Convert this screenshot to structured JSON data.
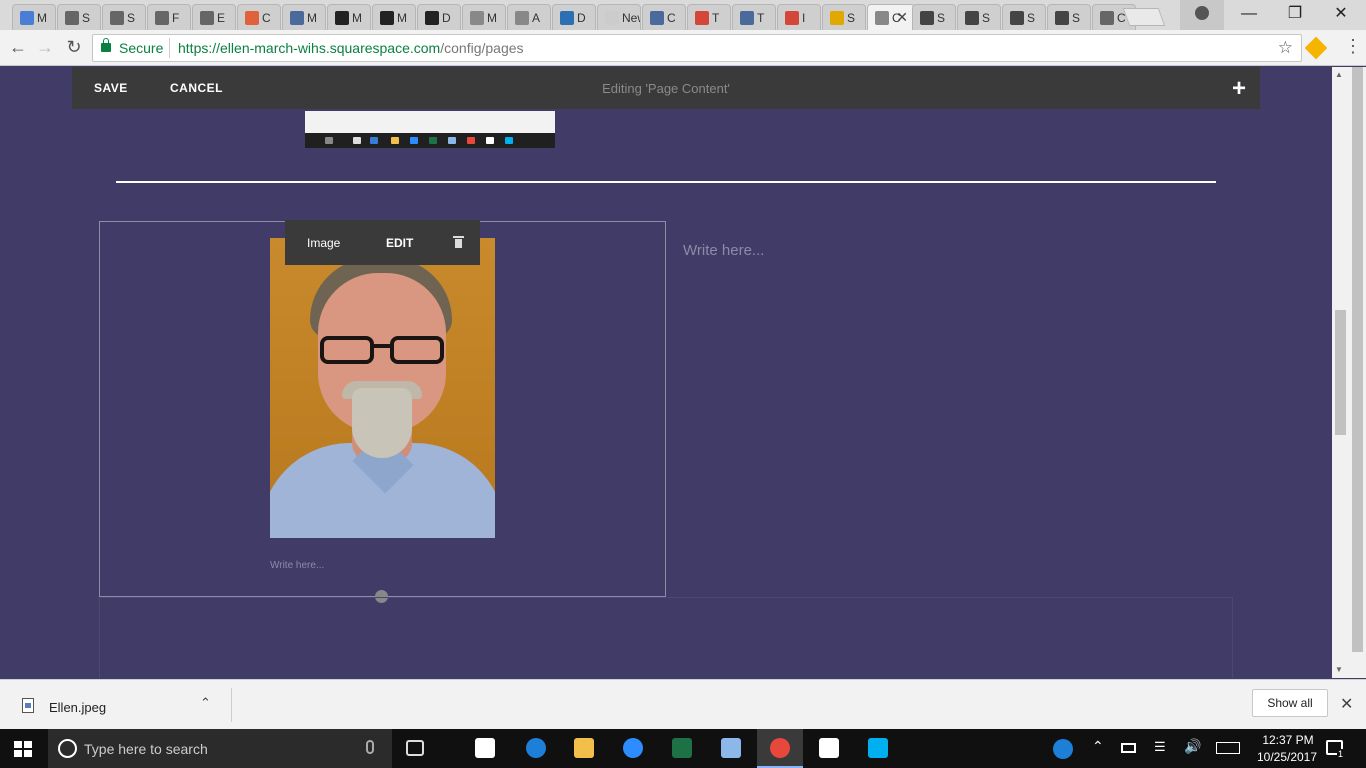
{
  "browser": {
    "tabs": [
      {
        "label": "M",
        "color": "#4a7ed6"
      },
      {
        "label": "S",
        "color": "#666"
      },
      {
        "label": "S",
        "color": "#666"
      },
      {
        "label": "F",
        "color": "#666"
      },
      {
        "label": "E",
        "color": "#666"
      },
      {
        "label": "C",
        "color": "#e0613b"
      },
      {
        "label": "M",
        "color": "#4b6a9c"
      },
      {
        "label": "M",
        "color": "#222"
      },
      {
        "label": "M",
        "color": "#222"
      },
      {
        "label": "D",
        "color": "#222"
      },
      {
        "label": "M",
        "color": "#888"
      },
      {
        "label": "A",
        "color": "#888"
      },
      {
        "label": "D",
        "color": "#2d6fb3"
      },
      {
        "label": "New",
        "color": "#ccc"
      },
      {
        "label": "C",
        "color": "#4b6a9c"
      },
      {
        "label": "T",
        "color": "#d44638"
      },
      {
        "label": "T",
        "color": "#4b6a9c"
      },
      {
        "label": "I",
        "color": "#d44638"
      },
      {
        "label": "S",
        "color": "#e0a800"
      },
      {
        "label": "C",
        "color": "#888"
      },
      {
        "label": "S",
        "color": "#444"
      },
      {
        "label": "S",
        "color": "#444"
      },
      {
        "label": "S",
        "color": "#444"
      },
      {
        "label": "S",
        "color": "#444"
      },
      {
        "label": "C",
        "color": "#666"
      }
    ],
    "active_tab_index": 19,
    "secure_label": "Secure",
    "url_host": "https://ellen-march-wihs.squarespace.com",
    "url_path": "/config/pages"
  },
  "editor": {
    "save_label": "SAVE",
    "cancel_label": "CANCEL",
    "title": "Editing 'Page Content'",
    "add_label": "+"
  },
  "image_toolbar": {
    "type_label": "Image",
    "edit_label": "EDIT"
  },
  "content": {
    "caption_placeholder": "Write here...",
    "text_placeholder": "Write here..."
  },
  "download_shelf": {
    "filename": "Ellen.jpeg",
    "show_all_label": "Show all"
  },
  "taskbar": {
    "search_placeholder": "Type here to search",
    "apps": [
      {
        "name": "task-view",
        "color": "#ddd"
      },
      {
        "name": "store",
        "color": "#ffffff"
      },
      {
        "name": "edge",
        "color": "#1e7fd9"
      },
      {
        "name": "file-explorer",
        "color": "#f2c04a"
      },
      {
        "name": "zoom",
        "color": "#2d8cff"
      },
      {
        "name": "excel",
        "color": "#1e7145"
      },
      {
        "name": "paint",
        "color": "#8bb8e8"
      },
      {
        "name": "chrome",
        "color": "#e8473c"
      },
      {
        "name": "photos",
        "color": "#ffffff"
      },
      {
        "name": "skype",
        "color": "#00aff0"
      }
    ],
    "active_app": "chrome",
    "time": "12:37 PM",
    "date": "10/25/2017",
    "notification_count": "1"
  }
}
